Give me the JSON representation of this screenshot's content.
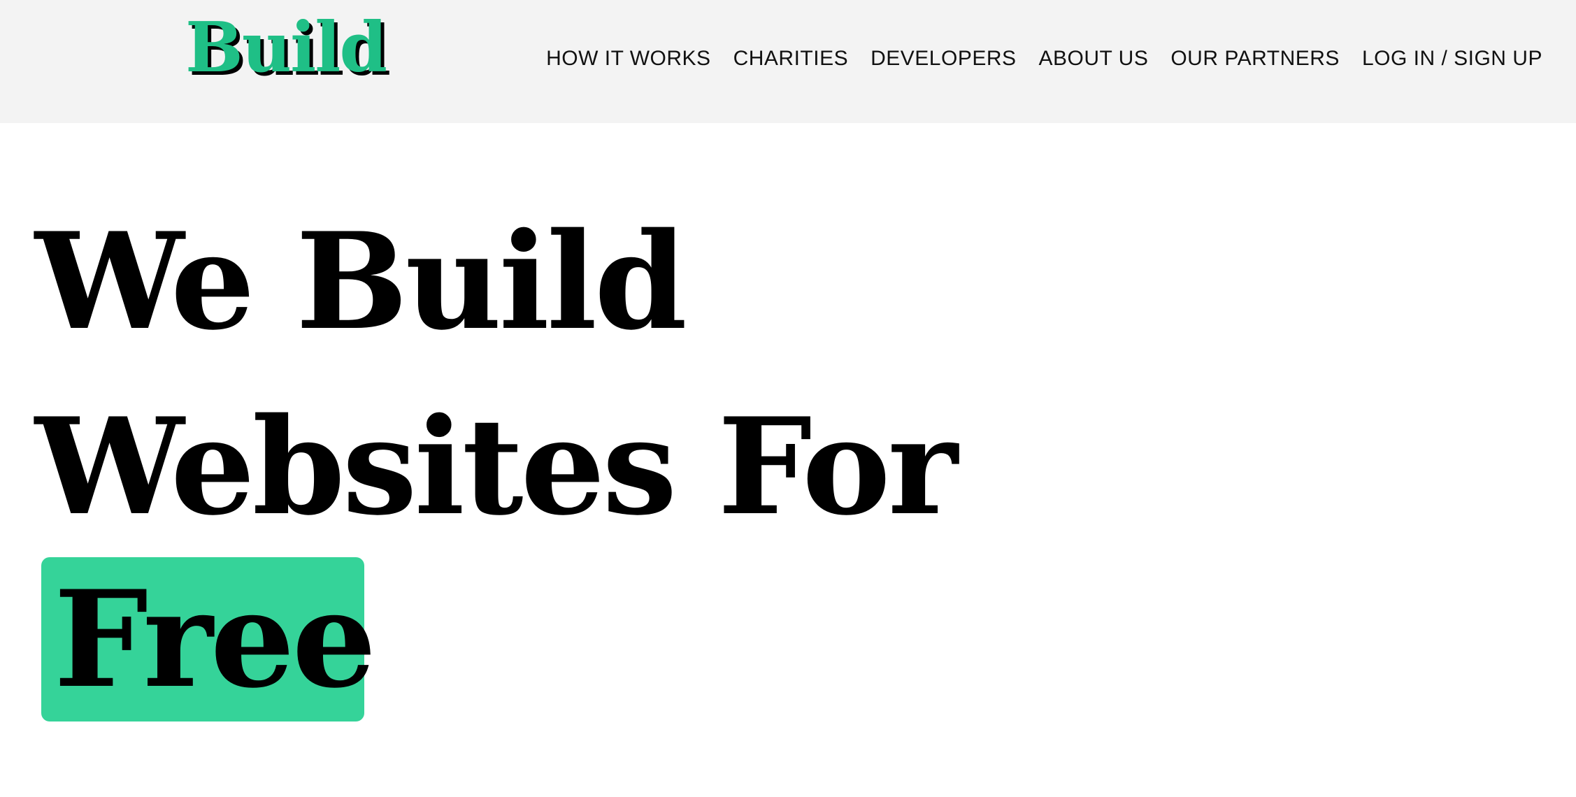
{
  "header": {
    "logo_text": "Build",
    "nav": [
      "HOW IT WORKS",
      "CHARITIES",
      "DEVELOPERS",
      "ABOUT US",
      "OUR PARTNERS",
      "LOG IN / SIGN UP"
    ]
  },
  "hero": {
    "line1": "We Build",
    "line2": "Websites For",
    "highlight": "Free"
  },
  "colors": {
    "accent": "#35d399",
    "logo": "#1fbf86",
    "header_bg": "#f3f3f3"
  }
}
